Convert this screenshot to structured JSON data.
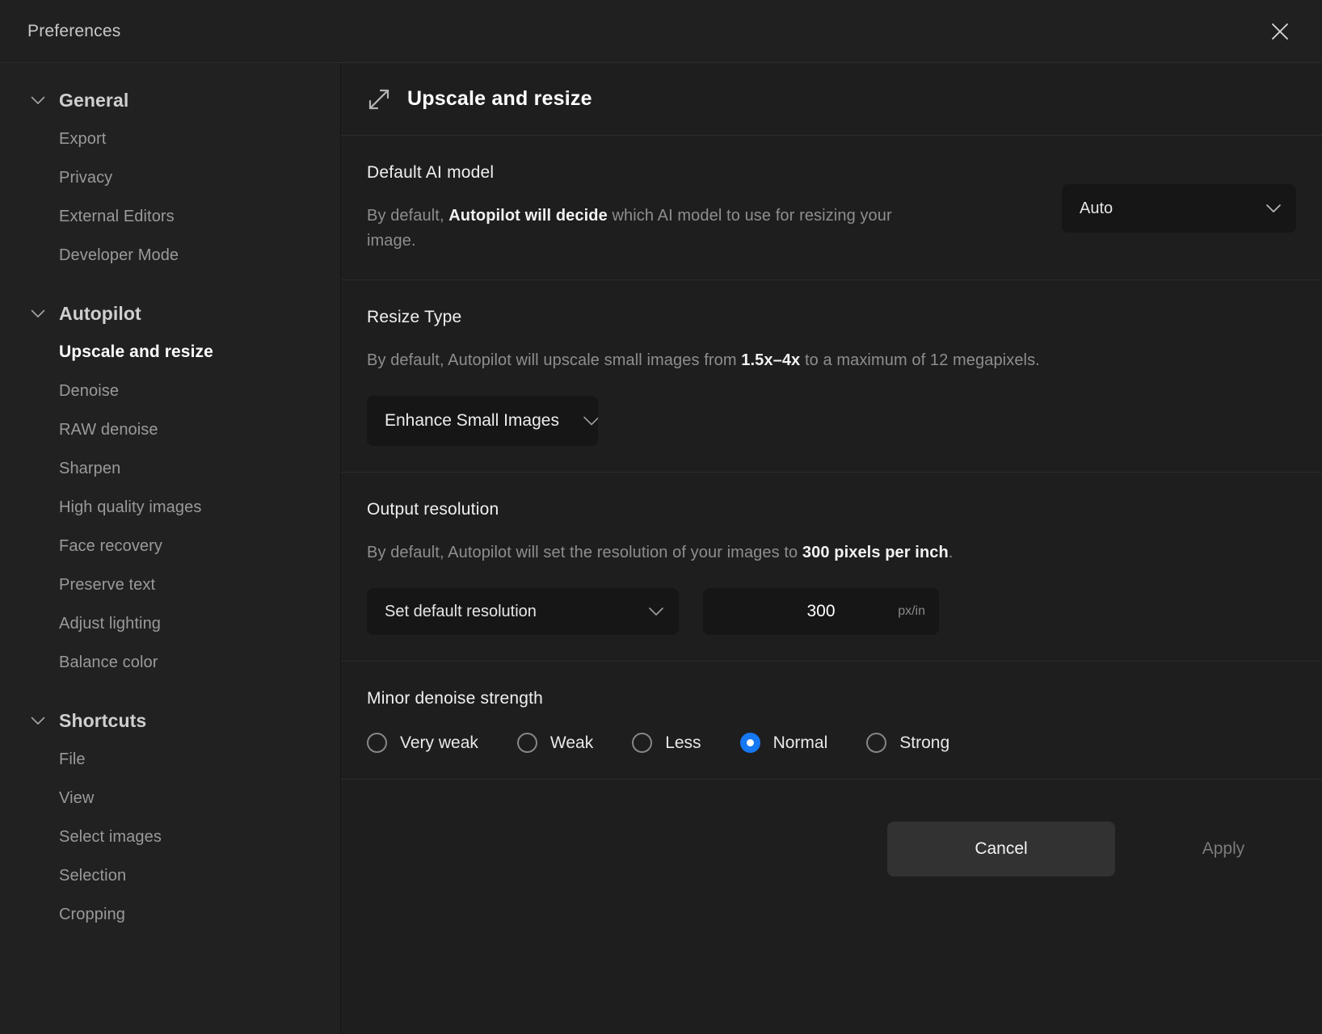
{
  "window": {
    "title": "Preferences",
    "close_icon": "close-icon"
  },
  "sidebar": {
    "groups": [
      {
        "title": "General",
        "expanded": true,
        "items": [
          {
            "label": "Export",
            "active": false
          },
          {
            "label": "Privacy",
            "active": false
          },
          {
            "label": "External Editors",
            "active": false
          },
          {
            "label": "Developer Mode",
            "active": false
          }
        ]
      },
      {
        "title": "Autopilot",
        "expanded": true,
        "items": [
          {
            "label": "Upscale and resize",
            "active": true
          },
          {
            "label": "Denoise",
            "active": false
          },
          {
            "label": "RAW denoise",
            "active": false
          },
          {
            "label": "Sharpen",
            "active": false
          },
          {
            "label": "High quality images",
            "active": false
          },
          {
            "label": "Face recovery",
            "active": false
          },
          {
            "label": "Preserve text",
            "active": false
          },
          {
            "label": "Adjust lighting",
            "active": false
          },
          {
            "label": "Balance color",
            "active": false
          }
        ]
      },
      {
        "title": "Shortcuts",
        "expanded": true,
        "items": [
          {
            "label": "File",
            "active": false
          },
          {
            "label": "View",
            "active": false
          },
          {
            "label": "Select images",
            "active": false
          },
          {
            "label": "Selection",
            "active": false
          },
          {
            "label": "Cropping",
            "active": false
          }
        ]
      }
    ]
  },
  "panel": {
    "header": {
      "icon": "resize-diagonal-icon",
      "title": "Upscale and resize"
    },
    "default_ai_model": {
      "title": "Default AI model",
      "description_pre": "By default, ",
      "description_bold": "Autopilot will decide",
      "description_post": " which AI model to use for resizing your image.",
      "dropdown_value": "Auto"
    },
    "resize_type": {
      "title": "Resize Type",
      "description_pre": "By default, Autopilot will upscale small images from ",
      "description_bold": "1.5x–4x",
      "description_post": " to a maximum of 12 megapixels.",
      "button_label": "Enhance Small Images"
    },
    "output_resolution": {
      "title": "Output resolution",
      "description_pre": "By default, Autopilot will set the resolution of your images to ",
      "description_bold": "300 pixels per inch",
      "description_post": ".",
      "dropdown_value": "Set default resolution",
      "resolution_value": "300",
      "resolution_unit": "px/in"
    },
    "minor_denoise": {
      "title": "Minor denoise strength",
      "options": [
        {
          "label": "Very weak",
          "selected": false
        },
        {
          "label": "Weak",
          "selected": false
        },
        {
          "label": "Less",
          "selected": false
        },
        {
          "label": "Normal",
          "selected": true
        },
        {
          "label": "Strong",
          "selected": false
        }
      ]
    },
    "footer": {
      "cancel_label": "Cancel",
      "apply_label": "Apply"
    }
  },
  "colors": {
    "accent": "#1678f2",
    "window_bg": "#1e1e1e",
    "sidebar_bg": "#212121",
    "control_bg": "#161616"
  }
}
